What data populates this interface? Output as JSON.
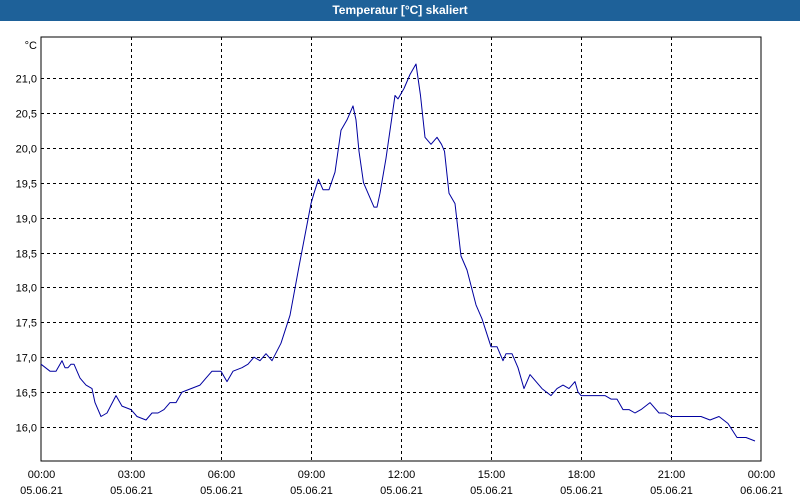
{
  "window": {
    "title": "Temperatur [°C] skaliert"
  },
  "chart_data": {
    "type": "line",
    "title": "Temperatur [°C] skaliert",
    "ylabel": "°C",
    "xlabel": "",
    "ylim": [
      15.6,
      21.35
    ],
    "xlim": [
      0,
      24
    ],
    "grid": true,
    "y_ticks": [
      "21,0",
      "20,5",
      "20,0",
      "19,5",
      "19,0",
      "18,5",
      "18,0",
      "17,5",
      "17,0",
      "16,5",
      "16,0"
    ],
    "y_tick_values": [
      21.0,
      20.5,
      20.0,
      19.5,
      19.0,
      18.5,
      18.0,
      17.5,
      17.0,
      16.5,
      16.0
    ],
    "x_ticks": [
      {
        "time": "00:00",
        "date": "05.06.21",
        "h": 0
      },
      {
        "time": "03:00",
        "date": "05.06.21",
        "h": 3
      },
      {
        "time": "06:00",
        "date": "05.06.21",
        "h": 6
      },
      {
        "time": "09:00",
        "date": "05.06.21",
        "h": 9
      },
      {
        "time": "12:00",
        "date": "05.06.21",
        "h": 12
      },
      {
        "time": "15:00",
        "date": "05.06.21",
        "h": 15
      },
      {
        "time": "18:00",
        "date": "05.06.21",
        "h": 18
      },
      {
        "time": "21:00",
        "date": "05.06.21",
        "h": 21
      },
      {
        "time": "00:00",
        "date": "06.06.21",
        "h": 24
      }
    ],
    "series": [
      {
        "color": "#0000a0",
        "x": [
          0,
          0.3,
          0.5,
          0.7,
          0.8,
          0.9,
          1.0,
          1.1,
          1.2,
          1.3,
          1.5,
          1.7,
          1.8,
          2.0,
          2.2,
          2.5,
          2.7,
          3.0,
          3.2,
          3.5,
          3.7,
          3.9,
          4.1,
          4.3,
          4.5,
          4.7,
          5.0,
          5.3,
          5.5,
          5.7,
          6.0,
          6.2,
          6.4,
          6.7,
          6.9,
          7.1,
          7.3,
          7.5,
          7.7,
          8.0,
          8.3,
          8.6,
          9.0,
          9.1,
          9.25,
          9.4,
          9.6,
          9.8,
          10.0,
          10.2,
          10.4,
          10.5,
          10.6,
          10.75,
          10.9,
          11.1,
          11.2,
          11.3,
          11.5,
          11.65,
          11.8,
          11.9,
          12.1,
          12.3,
          12.5,
          12.65,
          12.8,
          13.0,
          13.2,
          13.35,
          13.45,
          13.6,
          13.8,
          14.0,
          14.2,
          14.5,
          14.7,
          15.0,
          15.2,
          15.4,
          15.5,
          15.7,
          15.9,
          16.1,
          16.3,
          16.5,
          16.7,
          17.0,
          17.2,
          17.4,
          17.6,
          17.8,
          17.9,
          18.0,
          18.2,
          18.4,
          18.6,
          18.8,
          19.0,
          19.2,
          19.4,
          19.6,
          19.8,
          20.0,
          20.3,
          20.6,
          20.8,
          21.0,
          21.2,
          21.4,
          21.6,
          22.0,
          22.3,
          22.6,
          22.9,
          23.2,
          23.5,
          23.8
        ],
        "y": [
          16.9,
          16.8,
          16.8,
          16.95,
          16.85,
          16.85,
          16.9,
          16.9,
          16.8,
          16.7,
          16.6,
          16.55,
          16.35,
          16.15,
          16.2,
          16.45,
          16.3,
          16.25,
          16.15,
          16.1,
          16.2,
          16.2,
          16.25,
          16.35,
          16.35,
          16.5,
          16.55,
          16.6,
          16.7,
          16.8,
          16.8,
          16.65,
          16.8,
          16.85,
          16.9,
          17.0,
          16.95,
          17.05,
          16.95,
          17.2,
          17.6,
          18.3,
          19.2,
          19.35,
          19.55,
          19.4,
          19.4,
          19.65,
          20.25,
          20.4,
          20.6,
          20.4,
          19.95,
          19.5,
          19.35,
          19.15,
          19.15,
          19.35,
          19.85,
          20.3,
          20.75,
          20.7,
          20.85,
          21.05,
          21.2,
          20.75,
          20.15,
          20.05,
          20.15,
          20.05,
          19.95,
          19.35,
          19.2,
          18.45,
          18.25,
          17.75,
          17.55,
          17.15,
          17.15,
          16.95,
          17.05,
          17.05,
          16.85,
          16.55,
          16.75,
          16.65,
          16.55,
          16.45,
          16.55,
          16.6,
          16.55,
          16.65,
          16.5,
          16.45,
          16.45,
          16.45,
          16.45,
          16.45,
          16.4,
          16.4,
          16.25,
          16.25,
          16.2,
          16.25,
          16.35,
          16.2,
          16.2,
          16.15,
          16.15,
          16.15,
          16.15,
          16.15,
          16.1,
          16.15,
          16.05,
          15.85,
          15.85,
          15.8
        ]
      }
    ]
  }
}
